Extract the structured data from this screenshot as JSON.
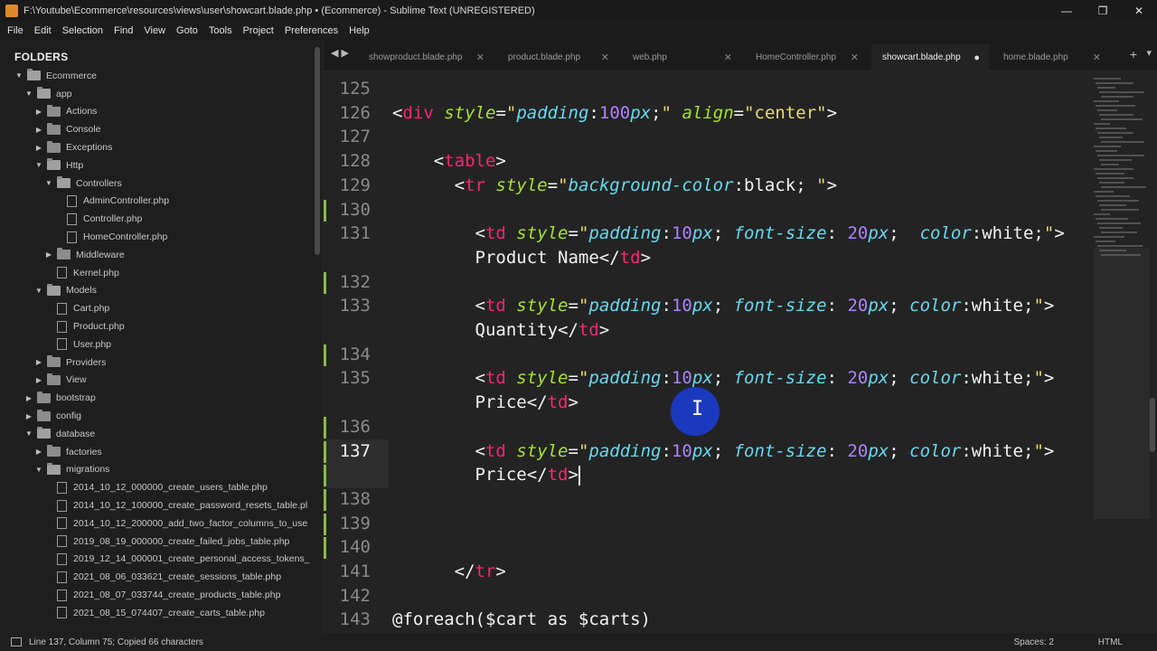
{
  "window": {
    "title": "F:\\Youtube\\Ecommerce\\resources\\views\\user\\showcart.blade.php • (Ecommerce) - Sublime Text (UNREGISTERED)",
    "controls": {
      "minimize": "—",
      "maximize": "❐",
      "close": "✕"
    }
  },
  "menu": [
    "File",
    "Edit",
    "Selection",
    "Find",
    "View",
    "Goto",
    "Tools",
    "Project",
    "Preferences",
    "Help"
  ],
  "sidebar": {
    "header": "FOLDERS",
    "items": [
      {
        "label": "Ecommerce",
        "depth": 0,
        "kind": "folder",
        "state": "open"
      },
      {
        "label": "app",
        "depth": 1,
        "kind": "folder",
        "state": "open"
      },
      {
        "label": "Actions",
        "depth": 2,
        "kind": "folder",
        "state": "closed"
      },
      {
        "label": "Console",
        "depth": 2,
        "kind": "folder",
        "state": "closed"
      },
      {
        "label": "Exceptions",
        "depth": 2,
        "kind": "folder",
        "state": "closed"
      },
      {
        "label": "Http",
        "depth": 2,
        "kind": "folder",
        "state": "open"
      },
      {
        "label": "Controllers",
        "depth": 3,
        "kind": "folder",
        "state": "open"
      },
      {
        "label": "AdminController.php",
        "depth": 4,
        "kind": "file"
      },
      {
        "label": "Controller.php",
        "depth": 4,
        "kind": "file"
      },
      {
        "label": "HomeController.php",
        "depth": 4,
        "kind": "file"
      },
      {
        "label": "Middleware",
        "depth": 3,
        "kind": "folder",
        "state": "closed"
      },
      {
        "label": "Kernel.php",
        "depth": 3,
        "kind": "file"
      },
      {
        "label": "Models",
        "depth": 2,
        "kind": "folder",
        "state": "open"
      },
      {
        "label": "Cart.php",
        "depth": 3,
        "kind": "file"
      },
      {
        "label": "Product.php",
        "depth": 3,
        "kind": "file"
      },
      {
        "label": "User.php",
        "depth": 3,
        "kind": "file"
      },
      {
        "label": "Providers",
        "depth": 2,
        "kind": "folder",
        "state": "closed"
      },
      {
        "label": "View",
        "depth": 2,
        "kind": "folder",
        "state": "closed"
      },
      {
        "label": "bootstrap",
        "depth": 1,
        "kind": "folder",
        "state": "closed"
      },
      {
        "label": "config",
        "depth": 1,
        "kind": "folder",
        "state": "closed"
      },
      {
        "label": "database",
        "depth": 1,
        "kind": "folder",
        "state": "open"
      },
      {
        "label": "factories",
        "depth": 2,
        "kind": "folder",
        "state": "closed"
      },
      {
        "label": "migrations",
        "depth": 2,
        "kind": "folder",
        "state": "open"
      },
      {
        "label": "2014_10_12_000000_create_users_table.php",
        "depth": 3,
        "kind": "file"
      },
      {
        "label": "2014_10_12_100000_create_password_resets_table.pl",
        "depth": 3,
        "kind": "file"
      },
      {
        "label": "2014_10_12_200000_add_two_factor_columns_to_use",
        "depth": 3,
        "kind": "file"
      },
      {
        "label": "2019_08_19_000000_create_failed_jobs_table.php",
        "depth": 3,
        "kind": "file"
      },
      {
        "label": "2019_12_14_000001_create_personal_access_tokens_",
        "depth": 3,
        "kind": "file"
      },
      {
        "label": "2021_08_06_033621_create_sessions_table.php",
        "depth": 3,
        "kind": "file"
      },
      {
        "label": "2021_08_07_033744_create_products_table.php",
        "depth": 3,
        "kind": "file"
      },
      {
        "label": "2021_08_15_074407_create_carts_table.php",
        "depth": 3,
        "kind": "file"
      }
    ]
  },
  "tabs": {
    "nav": "◀ ▶",
    "items": [
      {
        "label": "showproduct.blade.php",
        "close": "✕",
        "active": false
      },
      {
        "label": "product.blade.php",
        "close": "✕",
        "active": false
      },
      {
        "label": "web.php",
        "close": "✕",
        "active": false
      },
      {
        "label": "HomeController.php",
        "close": "✕",
        "active": false
      },
      {
        "label": "showcart.blade.php",
        "close": "●",
        "active": true
      },
      {
        "label": "home.blade.php",
        "close": "✕",
        "active": false
      }
    ],
    "plus": "+",
    "more": "▾"
  },
  "editor": {
    "current_line": 137,
    "lines": [
      {
        "num": "125",
        "tokens": []
      },
      {
        "num": "126",
        "tokens": [
          [
            "pun",
            "<"
          ],
          [
            "tag",
            "div"
          ],
          [
            "pun",
            " "
          ],
          [
            "attr",
            "style"
          ],
          [
            "pun",
            "="
          ],
          [
            "str",
            "\""
          ],
          [
            "prop",
            "padding"
          ],
          [
            "pun",
            ":"
          ],
          [
            "num",
            "100"
          ],
          [
            "prop",
            "px"
          ],
          [
            "pun",
            ";"
          ],
          [
            "str",
            "\""
          ],
          [
            "pun",
            " "
          ],
          [
            "attr",
            "align"
          ],
          [
            "pun",
            "="
          ],
          [
            "str",
            "\"center\""
          ],
          [
            "pun",
            ">"
          ]
        ]
      },
      {
        "num": "127",
        "tokens": []
      },
      {
        "num": "128",
        "tokens": [
          [
            "pun",
            "    <"
          ],
          [
            "tag",
            "table"
          ],
          [
            "pun",
            ">"
          ]
        ]
      },
      {
        "num": "129",
        "tokens": [
          [
            "pun",
            "      <"
          ],
          [
            "tag",
            "tr"
          ],
          [
            "pun",
            " "
          ],
          [
            "attr",
            "style"
          ],
          [
            "pun",
            "="
          ],
          [
            "str",
            "\""
          ],
          [
            "prop",
            "background-color"
          ],
          [
            "pun",
            ":"
          ],
          [
            "pun",
            "black"
          ],
          [
            "pun",
            "; "
          ],
          [
            "str",
            "\""
          ],
          [
            "pun",
            ">"
          ]
        ]
      },
      {
        "num": "130",
        "tokens": [],
        "mod": true
      },
      {
        "num": "131",
        "tokens": [
          [
            "pun",
            "        <"
          ],
          [
            "tag",
            "td"
          ],
          [
            "pun",
            " "
          ],
          [
            "attr",
            "style"
          ],
          [
            "pun",
            "="
          ],
          [
            "str",
            "\""
          ],
          [
            "prop",
            "padding"
          ],
          [
            "pun",
            ":"
          ],
          [
            "num",
            "10"
          ],
          [
            "prop",
            "px"
          ],
          [
            "pun",
            "; "
          ],
          [
            "prop",
            "font-size"
          ],
          [
            "pun",
            ": "
          ],
          [
            "num",
            "20"
          ],
          [
            "prop",
            "px"
          ],
          [
            "pun",
            ";  "
          ],
          [
            "prop",
            "color"
          ],
          [
            "pun",
            ":"
          ],
          [
            "pun",
            "white"
          ],
          [
            "pun",
            ";"
          ],
          [
            "str",
            "\""
          ],
          [
            "pun",
            ">"
          ]
        ]
      },
      {
        "num": "",
        "tokens": [
          [
            "pun",
            "        Product Name</"
          ],
          [
            "tag",
            "td"
          ],
          [
            "pun",
            ">"
          ]
        ]
      },
      {
        "num": "132",
        "tokens": [],
        "mod": true
      },
      {
        "num": "133",
        "tokens": [
          [
            "pun",
            "        <"
          ],
          [
            "tag",
            "td"
          ],
          [
            "pun",
            " "
          ],
          [
            "attr",
            "style"
          ],
          [
            "pun",
            "="
          ],
          [
            "str",
            "\""
          ],
          [
            "prop",
            "padding"
          ],
          [
            "pun",
            ":"
          ],
          [
            "num",
            "10"
          ],
          [
            "prop",
            "px"
          ],
          [
            "pun",
            "; "
          ],
          [
            "prop",
            "font-size"
          ],
          [
            "pun",
            ": "
          ],
          [
            "num",
            "20"
          ],
          [
            "prop",
            "px"
          ],
          [
            "pun",
            "; "
          ],
          [
            "prop",
            "color"
          ],
          [
            "pun",
            ":"
          ],
          [
            "pun",
            "white"
          ],
          [
            "pun",
            ";"
          ],
          [
            "str",
            "\""
          ],
          [
            "pun",
            ">"
          ]
        ]
      },
      {
        "num": "",
        "tokens": [
          [
            "pun",
            "        Quantity</"
          ],
          [
            "tag",
            "td"
          ],
          [
            "pun",
            ">"
          ]
        ]
      },
      {
        "num": "134",
        "tokens": [],
        "mod": true
      },
      {
        "num": "135",
        "tokens": [
          [
            "pun",
            "        <"
          ],
          [
            "tag",
            "td"
          ],
          [
            "pun",
            " "
          ],
          [
            "attr",
            "style"
          ],
          [
            "pun",
            "="
          ],
          [
            "str",
            "\""
          ],
          [
            "prop",
            "padding"
          ],
          [
            "pun",
            ":"
          ],
          [
            "num",
            "10"
          ],
          [
            "prop",
            "px"
          ],
          [
            "pun",
            "; "
          ],
          [
            "prop",
            "font-size"
          ],
          [
            "pun",
            ": "
          ],
          [
            "num",
            "20"
          ],
          [
            "prop",
            "px"
          ],
          [
            "pun",
            "; "
          ],
          [
            "prop",
            "color"
          ],
          [
            "pun",
            ":"
          ],
          [
            "pun",
            "white"
          ],
          [
            "pun",
            ";"
          ],
          [
            "str",
            "\""
          ],
          [
            "pun",
            ">"
          ]
        ]
      },
      {
        "num": "",
        "tokens": [
          [
            "pun",
            "        Price</"
          ],
          [
            "tag",
            "td"
          ],
          [
            "pun",
            ">"
          ]
        ]
      },
      {
        "num": "136",
        "tokens": [],
        "mod": true
      },
      {
        "num": "137",
        "tokens": [
          [
            "pun",
            "        <"
          ],
          [
            "tag",
            "td"
          ],
          [
            "pun",
            " "
          ],
          [
            "attr",
            "style"
          ],
          [
            "pun",
            "="
          ],
          [
            "str",
            "\""
          ],
          [
            "prop",
            "padding"
          ],
          [
            "pun",
            ":"
          ],
          [
            "num",
            "10"
          ],
          [
            "prop",
            "px"
          ],
          [
            "pun",
            "; "
          ],
          [
            "prop",
            "font-size"
          ],
          [
            "pun",
            ": "
          ],
          [
            "num",
            "20"
          ],
          [
            "prop",
            "px"
          ],
          [
            "pun",
            "; "
          ],
          [
            "prop",
            "color"
          ],
          [
            "pun",
            ":"
          ],
          [
            "pun",
            "white"
          ],
          [
            "pun",
            ";"
          ],
          [
            "str",
            "\""
          ],
          [
            "pun",
            ">"
          ]
        ],
        "mod": true,
        "current": true
      },
      {
        "num": "",
        "tokens": [
          [
            "pun",
            "        Price</"
          ],
          [
            "tag",
            "td"
          ],
          [
            "pun",
            ">"
          ]
        ],
        "mod": true,
        "caret": true
      },
      {
        "num": "138",
        "tokens": [],
        "mod": true
      },
      {
        "num": "139",
        "tokens": [],
        "mod": true
      },
      {
        "num": "140",
        "tokens": [],
        "mod": true
      },
      {
        "num": "141",
        "tokens": [
          [
            "pun",
            "      </"
          ],
          [
            "tag",
            "tr"
          ],
          [
            "pun",
            ">"
          ]
        ]
      },
      {
        "num": "142",
        "tokens": []
      },
      {
        "num": "143",
        "tokens": [
          [
            "pun",
            "@foreach($cart as $carts)"
          ]
        ]
      }
    ]
  },
  "statusbar": {
    "position": "Line 137, Column 75; Copied 66 characters",
    "spaces": "Spaces: 2",
    "syntax": "HTML"
  },
  "colors": {
    "tag": "#f92672",
    "attr": "#a6e22e",
    "prop": "#66d9ef",
    "num": "#ae81ff",
    "str": "#e6db74",
    "background": "#232323",
    "modified_marker": "#8bb84a"
  }
}
